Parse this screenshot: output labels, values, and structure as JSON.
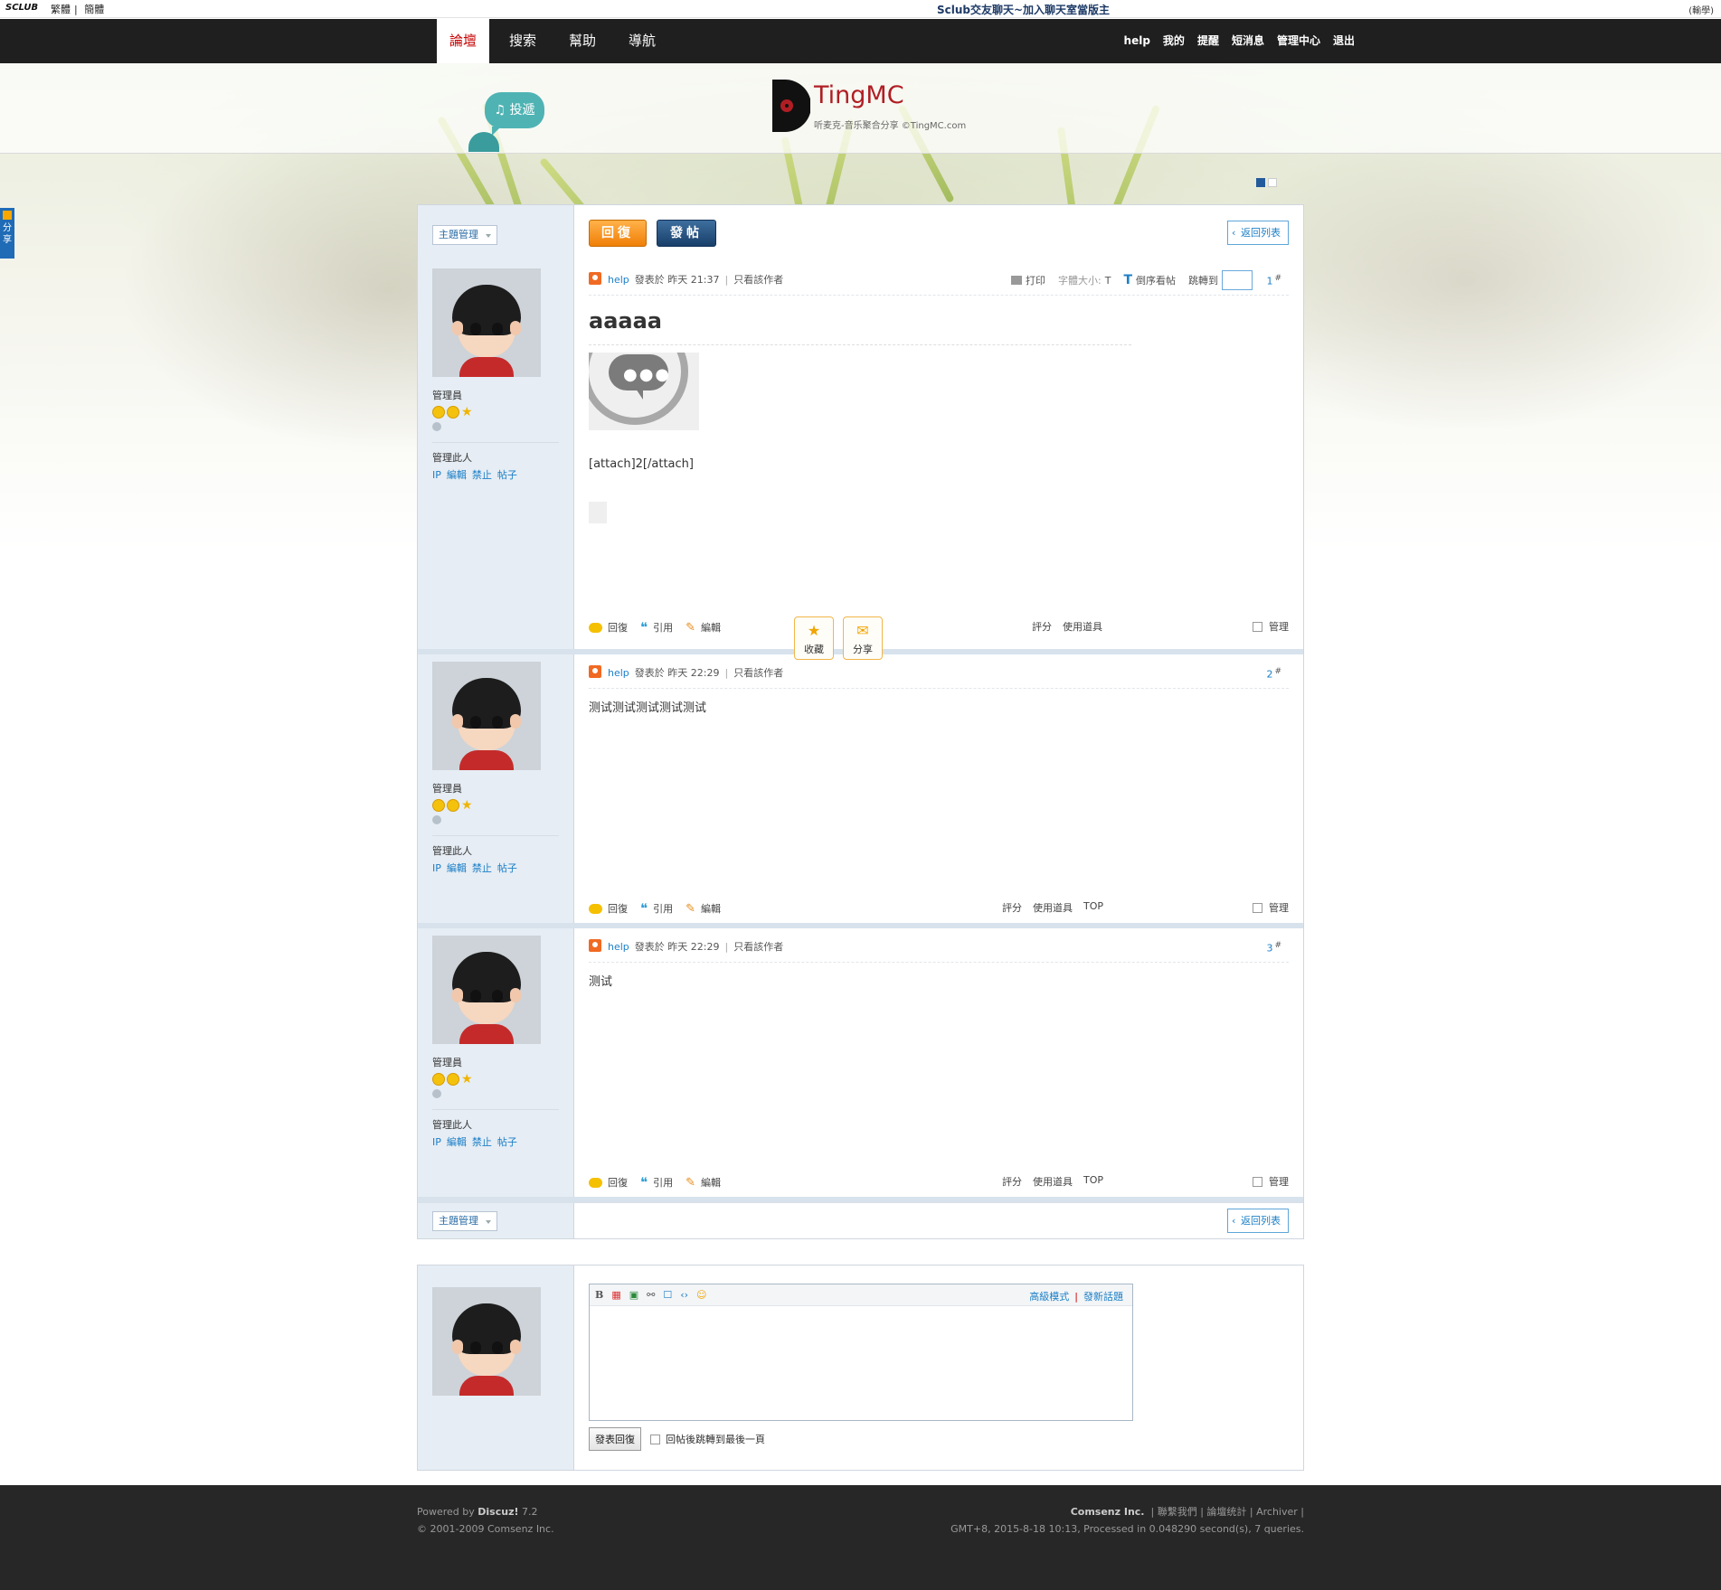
{
  "topbar": {
    "brand": "SCLUB",
    "lang_trad": "繁體",
    "lang_simp": "簡體",
    "center_title": "Sclub交友聊天~加入聊天室當版主",
    "right_text": "(輸學)"
  },
  "nav": {
    "main": [
      "論壇",
      "搜索",
      "幫助",
      "導航"
    ],
    "active_index": 0,
    "user": [
      "help",
      "我的",
      "提醒",
      "短消息",
      "管理中心",
      "退出"
    ]
  },
  "header": {
    "logo_title": "TingMC",
    "logo_subtitle": "听麦克-音乐聚合分享 ©TingMC.com",
    "bubble_label": "♫ 投遞"
  },
  "share_tab": "分享",
  "toolbar": {
    "manage_label": "主題管理",
    "reply_label": "回復",
    "post_label": "發帖",
    "back_label": "返回列表"
  },
  "post_tools": {
    "print": "打印",
    "font_size": "字體大小:",
    "font_t": "T",
    "reverse": "倒序看帖",
    "jump": "跳轉到"
  },
  "user_panel": {
    "role": "管理員",
    "manage_title": "管理此人",
    "links": [
      "IP",
      "編輯",
      "禁止",
      "帖子"
    ]
  },
  "posts": [
    {
      "author": "help",
      "posted": "發表於 昨天 21:37",
      "only_author": "只看該作者",
      "floor": "1",
      "title": "aaaaa",
      "body": "[attach]2[/attach]",
      "fav_label": "收藏",
      "share_label": "分享"
    },
    {
      "author": "help",
      "posted": "發表於 昨天 22:29",
      "only_author": "只看該作者",
      "floor": "2",
      "body": "测试测试测试测试测试"
    },
    {
      "author": "help",
      "posted": "發表於 昨天 22:29",
      "only_author": "只看該作者",
      "floor": "3",
      "body": "测试"
    }
  ],
  "post_actions": {
    "reply": "回復",
    "quote": "引用",
    "edit": "編輯",
    "rate": "評分",
    "tools": "使用道具",
    "top": "TOP",
    "manage": "管理"
  },
  "floor_mark": "#",
  "reply_box": {
    "editor_icons": [
      "B",
      "▦",
      "▣",
      "⚯",
      "☐",
      "‹›",
      "☺"
    ],
    "advanced": "高級模式",
    "new_topic": "發新話題",
    "submit": "發表回復",
    "jump_last": "回帖後跳轉到最後一頁"
  },
  "footer": {
    "powered_prefix": "Powered by ",
    "powered_brand": "Discuz!",
    "powered_version": " 7.2",
    "copyright": "© 2001-2009 Comsenz Inc.",
    "company": "Comsenz Inc.",
    "links": [
      "聯繫我們",
      "論壇统計",
      "Archiver"
    ],
    "stats": "GMT+8, 2015-8-18 10:13, Processed in 0.048290 second(s), 7 queries."
  }
}
